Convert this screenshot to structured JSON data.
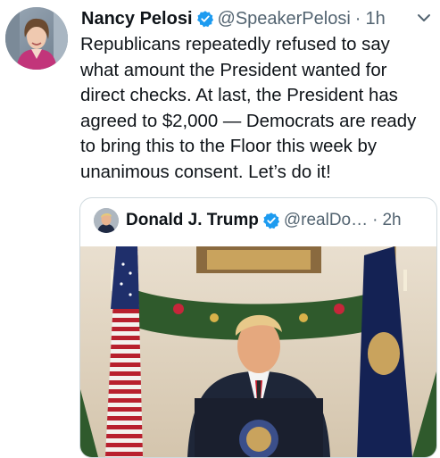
{
  "tweet": {
    "author_name": "Nancy Pelosi",
    "author_handle": "@SpeakerPelosi",
    "separator": "·",
    "time": "1h",
    "verified_icon": "verified-badge-icon",
    "more_icon": "chevron-down-icon",
    "lines": [
      "Republicans repeatedly refused to say",
      "what amount the President wanted for",
      "direct checks. At last, the President has",
      "agreed to $2,000 — Democrats are ready",
      "to bring this to the Floor this week by",
      "unanimous consent. Let’s do it!"
    ]
  },
  "quote": {
    "author_name": "Donald J. Trump",
    "author_handle": "@realDo…",
    "separator": "·",
    "time": "2h",
    "verified_icon": "verified-badge-icon"
  },
  "colors": {
    "text": "#0f1419",
    "secondary": "#536471",
    "verified": "#1d9bf0",
    "border": "#cfd9de"
  }
}
